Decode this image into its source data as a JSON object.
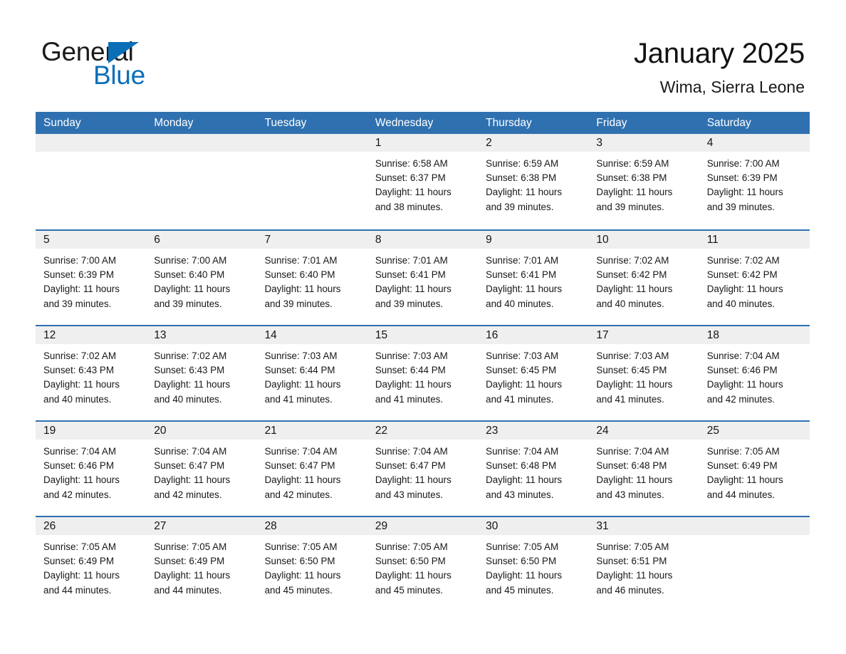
{
  "brand": {
    "name_part1": "General",
    "name_part2": "Blue",
    "triangle_color": "#0b6fb8",
    "text_color": "#1b1b1b"
  },
  "header": {
    "title": "January 2025",
    "subtitle": "Wima, Sierra Leone"
  },
  "theme": {
    "header_blue": "#2f71b0",
    "row_divider_blue": "#2f71b0",
    "daynum_band_gray": "#efefef",
    "text_color": "#171717"
  },
  "weekdays": [
    "Sunday",
    "Monday",
    "Tuesday",
    "Wednesday",
    "Thursday",
    "Friday",
    "Saturday"
  ],
  "labels": {
    "sunrise_prefix": "Sunrise:",
    "sunset_prefix": "Sunset:",
    "daylight_prefix": "Daylight:"
  },
  "weeks": [
    [
      {
        "day": "",
        "line1": "",
        "line2": "",
        "line3": "",
        "line4": ""
      },
      {
        "day": "",
        "line1": "",
        "line2": "",
        "line3": "",
        "line4": ""
      },
      {
        "day": "",
        "line1": "",
        "line2": "",
        "line3": "",
        "line4": ""
      },
      {
        "day": "1",
        "line1": "Sunrise: 6:58 AM",
        "line2": "Sunset: 6:37 PM",
        "line3": "Daylight: 11 hours",
        "line4": "and 38 minutes."
      },
      {
        "day": "2",
        "line1": "Sunrise: 6:59 AM",
        "line2": "Sunset: 6:38 PM",
        "line3": "Daylight: 11 hours",
        "line4": "and 39 minutes."
      },
      {
        "day": "3",
        "line1": "Sunrise: 6:59 AM",
        "line2": "Sunset: 6:38 PM",
        "line3": "Daylight: 11 hours",
        "line4": "and 39 minutes."
      },
      {
        "day": "4",
        "line1": "Sunrise: 7:00 AM",
        "line2": "Sunset: 6:39 PM",
        "line3": "Daylight: 11 hours",
        "line4": "and 39 minutes."
      }
    ],
    [
      {
        "day": "5",
        "line1": "Sunrise: 7:00 AM",
        "line2": "Sunset: 6:39 PM",
        "line3": "Daylight: 11 hours",
        "line4": "and 39 minutes."
      },
      {
        "day": "6",
        "line1": "Sunrise: 7:00 AM",
        "line2": "Sunset: 6:40 PM",
        "line3": "Daylight: 11 hours",
        "line4": "and 39 minutes."
      },
      {
        "day": "7",
        "line1": "Sunrise: 7:01 AM",
        "line2": "Sunset: 6:40 PM",
        "line3": "Daylight: 11 hours",
        "line4": "and 39 minutes."
      },
      {
        "day": "8",
        "line1": "Sunrise: 7:01 AM",
        "line2": "Sunset: 6:41 PM",
        "line3": "Daylight: 11 hours",
        "line4": "and 39 minutes."
      },
      {
        "day": "9",
        "line1": "Sunrise: 7:01 AM",
        "line2": "Sunset: 6:41 PM",
        "line3": "Daylight: 11 hours",
        "line4": "and 40 minutes."
      },
      {
        "day": "10",
        "line1": "Sunrise: 7:02 AM",
        "line2": "Sunset: 6:42 PM",
        "line3": "Daylight: 11 hours",
        "line4": "and 40 minutes."
      },
      {
        "day": "11",
        "line1": "Sunrise: 7:02 AM",
        "line2": "Sunset: 6:42 PM",
        "line3": "Daylight: 11 hours",
        "line4": "and 40 minutes."
      }
    ],
    [
      {
        "day": "12",
        "line1": "Sunrise: 7:02 AM",
        "line2": "Sunset: 6:43 PM",
        "line3": "Daylight: 11 hours",
        "line4": "and 40 minutes."
      },
      {
        "day": "13",
        "line1": "Sunrise: 7:02 AM",
        "line2": "Sunset: 6:43 PM",
        "line3": "Daylight: 11 hours",
        "line4": "and 40 minutes."
      },
      {
        "day": "14",
        "line1": "Sunrise: 7:03 AM",
        "line2": "Sunset: 6:44 PM",
        "line3": "Daylight: 11 hours",
        "line4": "and 41 minutes."
      },
      {
        "day": "15",
        "line1": "Sunrise: 7:03 AM",
        "line2": "Sunset: 6:44 PM",
        "line3": "Daylight: 11 hours",
        "line4": "and 41 minutes."
      },
      {
        "day": "16",
        "line1": "Sunrise: 7:03 AM",
        "line2": "Sunset: 6:45 PM",
        "line3": "Daylight: 11 hours",
        "line4": "and 41 minutes."
      },
      {
        "day": "17",
        "line1": "Sunrise: 7:03 AM",
        "line2": "Sunset: 6:45 PM",
        "line3": "Daylight: 11 hours",
        "line4": "and 41 minutes."
      },
      {
        "day": "18",
        "line1": "Sunrise: 7:04 AM",
        "line2": "Sunset: 6:46 PM",
        "line3": "Daylight: 11 hours",
        "line4": "and 42 minutes."
      }
    ],
    [
      {
        "day": "19",
        "line1": "Sunrise: 7:04 AM",
        "line2": "Sunset: 6:46 PM",
        "line3": "Daylight: 11 hours",
        "line4": "and 42 minutes."
      },
      {
        "day": "20",
        "line1": "Sunrise: 7:04 AM",
        "line2": "Sunset: 6:47 PM",
        "line3": "Daylight: 11 hours",
        "line4": "and 42 minutes."
      },
      {
        "day": "21",
        "line1": "Sunrise: 7:04 AM",
        "line2": "Sunset: 6:47 PM",
        "line3": "Daylight: 11 hours",
        "line4": "and 42 minutes."
      },
      {
        "day": "22",
        "line1": "Sunrise: 7:04 AM",
        "line2": "Sunset: 6:47 PM",
        "line3": "Daylight: 11 hours",
        "line4": "and 43 minutes."
      },
      {
        "day": "23",
        "line1": "Sunrise: 7:04 AM",
        "line2": "Sunset: 6:48 PM",
        "line3": "Daylight: 11 hours",
        "line4": "and 43 minutes."
      },
      {
        "day": "24",
        "line1": "Sunrise: 7:04 AM",
        "line2": "Sunset: 6:48 PM",
        "line3": "Daylight: 11 hours",
        "line4": "and 43 minutes."
      },
      {
        "day": "25",
        "line1": "Sunrise: 7:05 AM",
        "line2": "Sunset: 6:49 PM",
        "line3": "Daylight: 11 hours",
        "line4": "and 44 minutes."
      }
    ],
    [
      {
        "day": "26",
        "line1": "Sunrise: 7:05 AM",
        "line2": "Sunset: 6:49 PM",
        "line3": "Daylight: 11 hours",
        "line4": "and 44 minutes."
      },
      {
        "day": "27",
        "line1": "Sunrise: 7:05 AM",
        "line2": "Sunset: 6:49 PM",
        "line3": "Daylight: 11 hours",
        "line4": "and 44 minutes."
      },
      {
        "day": "28",
        "line1": "Sunrise: 7:05 AM",
        "line2": "Sunset: 6:50 PM",
        "line3": "Daylight: 11 hours",
        "line4": "and 45 minutes."
      },
      {
        "day": "29",
        "line1": "Sunrise: 7:05 AM",
        "line2": "Sunset: 6:50 PM",
        "line3": "Daylight: 11 hours",
        "line4": "and 45 minutes."
      },
      {
        "day": "30",
        "line1": "Sunrise: 7:05 AM",
        "line2": "Sunset: 6:50 PM",
        "line3": "Daylight: 11 hours",
        "line4": "and 45 minutes."
      },
      {
        "day": "31",
        "line1": "Sunrise: 7:05 AM",
        "line2": "Sunset: 6:51 PM",
        "line3": "Daylight: 11 hours",
        "line4": "and 46 minutes."
      },
      {
        "day": "",
        "line1": "",
        "line2": "",
        "line3": "",
        "line4": ""
      }
    ]
  ]
}
